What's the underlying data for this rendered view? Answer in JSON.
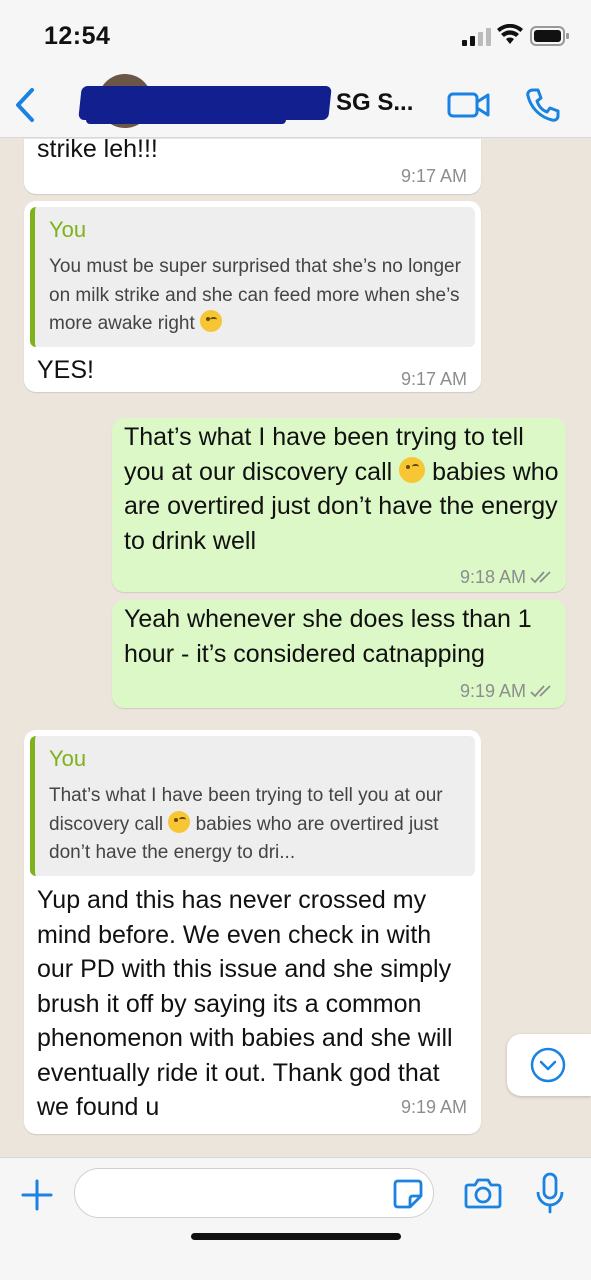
{
  "status_bar": {
    "time": "12:54"
  },
  "header": {
    "contact_name": "SG S..."
  },
  "messages": [
    {
      "partial_text": "strike leh!!!",
      "time": "9:17 AM"
    },
    {
      "quote_author": "You",
      "quote_text_1": "You must be super surprised that she’s no longer on milk strike and she can feed more when she’s more awake right",
      "text": "YES!",
      "time": "9:17 AM"
    },
    {
      "text_1": "That’s what I have been trying to tell you at our discovery call",
      "text_2": "babies who are overtired just don’t have the energy to drink well",
      "time": "9:18 AM"
    },
    {
      "text": "Yeah whenever she does less than 1 hour - it’s considered catnapping",
      "time": "9:19 AM"
    },
    {
      "quote_author": "You",
      "quote_text_1": "That’s what I have been trying to tell you at our discovery call",
      "quote_text_2": "babies who are overtired just don’t have the energy to dri...",
      "text": "Yup and this has never crossed my mind before. We even check in with our PD with this issue and she simply brush it off by saying its a common phenomenon with babies and she will eventually ride it out. Thank god that we found u",
      "time": "9:19 AM"
    }
  ],
  "input": {
    "value": "",
    "placeholder": ""
  },
  "colors": {
    "outgoing_bubble": "#dcf8c6",
    "quote_accent": "#7fb11b",
    "ios_blue": "#1a82e2"
  }
}
